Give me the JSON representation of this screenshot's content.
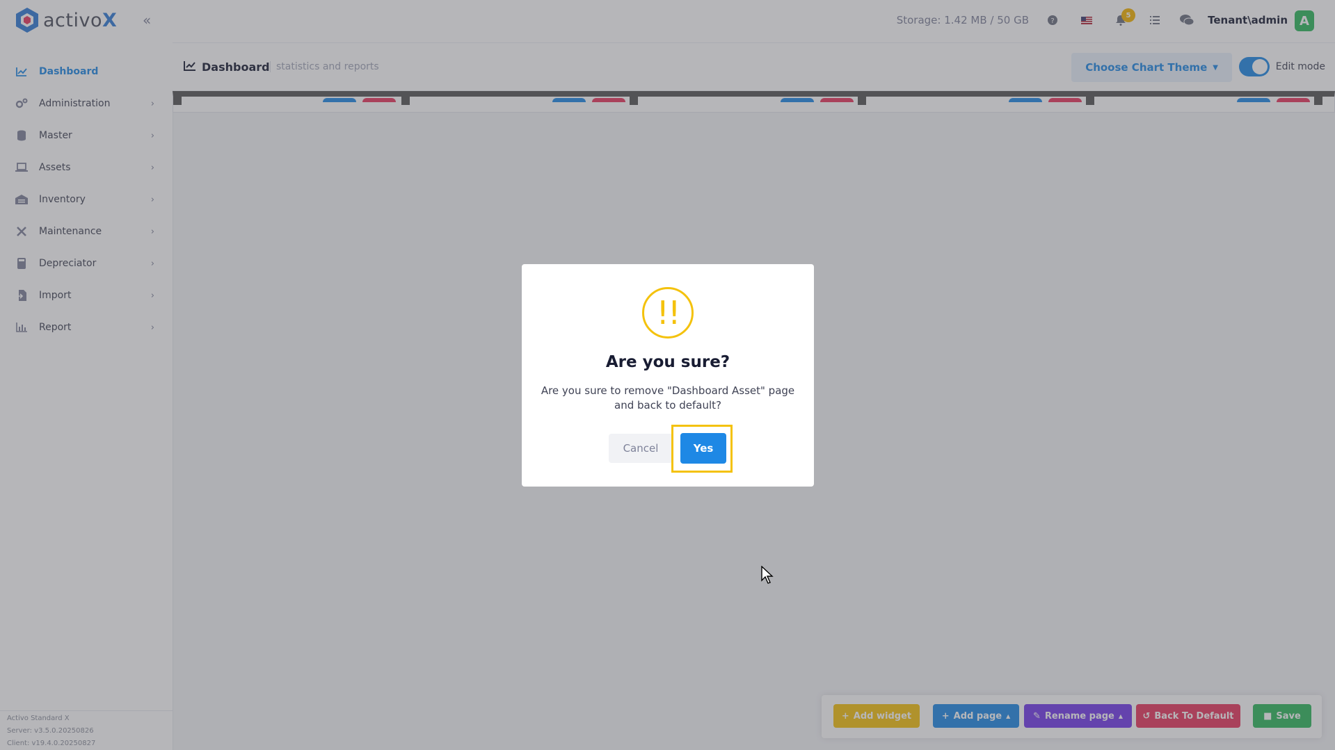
{
  "app": {
    "logo_text_main": "activo",
    "logo_text_accent": "X"
  },
  "sidebar": {
    "items": [
      {
        "label": "Dashboard",
        "icon": "chart-line-icon",
        "active": true
      },
      {
        "label": "Administration",
        "icon": "cogs-icon"
      },
      {
        "label": "Master",
        "icon": "database-icon"
      },
      {
        "label": "Assets",
        "icon": "laptop-icon"
      },
      {
        "label": "Inventory",
        "icon": "warehouse-icon"
      },
      {
        "label": "Maintenance",
        "icon": "tools-icon"
      },
      {
        "label": "Depreciator",
        "icon": "calculator-icon"
      },
      {
        "label": "Import",
        "icon": "file-import-icon"
      },
      {
        "label": "Report",
        "icon": "chart-bar-icon"
      }
    ],
    "version": {
      "product": "Activo Standard X",
      "server": "Server: v3.5.0.20250826",
      "client": "Client: v19.4.0.20250827"
    }
  },
  "topbar": {
    "storage": "Storage: 1.42 MB / 50 GB",
    "notification_count": "5",
    "user": "Tenant\\admin",
    "avatar_letter": "A"
  },
  "subheader": {
    "title": "Dashboard",
    "subtitle": "statistics and reports",
    "theme_button": "Choose Chart Theme",
    "edit_mode_label": "Edit mode"
  },
  "toolbar": {
    "add_widget": "Add widget",
    "add_page": "Add page",
    "rename_page": "Rename page",
    "back_to_default": "Back To Default",
    "save": "Save"
  },
  "dialog": {
    "icon": "!!",
    "title": "Are you sure?",
    "message": "Are you sure to remove \"Dashboard Asset\" page and back to default?",
    "cancel": "Cancel",
    "confirm": "Yes"
  },
  "colors": {
    "primary": "#1e88e5",
    "warning": "#f4c20d",
    "danger": "#e8365d",
    "success": "#2eb85c",
    "purple": "#7239ea"
  }
}
